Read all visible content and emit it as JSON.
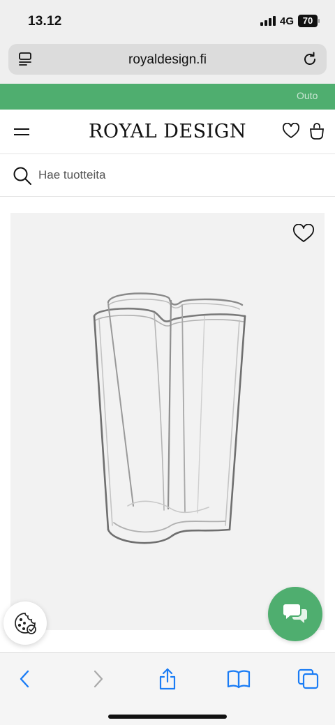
{
  "status_bar": {
    "time": "13.12",
    "network": "4G",
    "battery": "70"
  },
  "browser": {
    "url": "royaldesign.fi",
    "icons": [
      "page-menu-icon",
      "reload-icon"
    ]
  },
  "announcement": {
    "text": "Outo",
    "color": "#4fae6f"
  },
  "header": {
    "logo": "ROYAL DESIGN",
    "icons": [
      "hamburger-menu-icon",
      "heart-icon",
      "shopping-bag-icon"
    ]
  },
  "search": {
    "placeholder": "Hae tuotteita"
  },
  "product": {
    "image": "vase-icon",
    "wishlist_icon": "heart-icon"
  },
  "floating": {
    "cookie_icon": "cookie-icon",
    "chat_icon": "chat-bubbles-icon",
    "chat_color": "#4fae6f"
  },
  "toolbar": {
    "items": [
      "back-icon",
      "forward-icon",
      "share-icon",
      "bookmarks-icon",
      "tabs-icon"
    ],
    "accent": "#1a7cf5"
  }
}
